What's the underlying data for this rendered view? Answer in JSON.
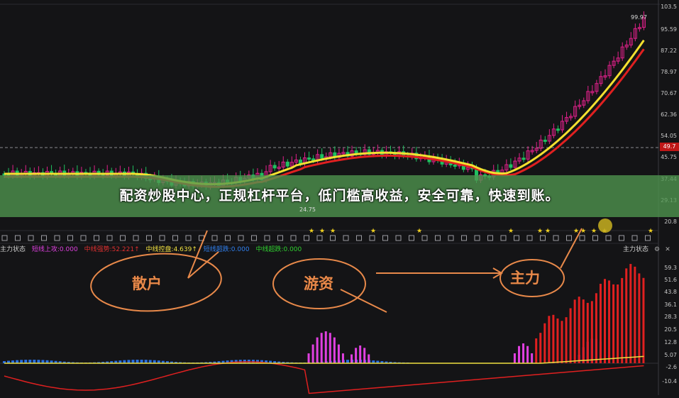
{
  "banner": {
    "text": "配资炒股中心，正规杠杆平台，低门槛高收益，安全可靠，快速到账。"
  },
  "price_axis": {
    "ticks": [
      "103.5",
      "95.59",
      "87.22",
      "78.97",
      "70.67",
      "62.36",
      "54.05",
      "45.75",
      "37.44",
      "29.13",
      "20.8"
    ],
    "current": "49.7"
  },
  "labels": {
    "high": "99.97",
    "low": "24.75"
  },
  "indicator": {
    "title": "主力状态",
    "right_title": "主力状态",
    "items": [
      {
        "label": "短线上攻:0.000",
        "color": "#e040e0"
      },
      {
        "label": "中线强势:52.221",
        "color": "#e03030",
        "arrow": "↑"
      },
      {
        "label": "中线控盘:4.639",
        "color": "#f0e040",
        "arrow": "↑"
      },
      {
        "label": "短线超跌:0.000",
        "color": "#3080f0"
      },
      {
        "label": "中线超跌:0.000",
        "color": "#30d030"
      }
    ],
    "axis": [
      "59.3",
      "51.6",
      "43.8",
      "36.1",
      "28.3",
      "20.5",
      "12.8",
      "5.07",
      "-2.6",
      "-10.4"
    ]
  },
  "annotations": {
    "retail": "散户",
    "hot_money": "游资",
    "main_force": "主力"
  },
  "colors": {
    "up": "#e0208a",
    "down": "#20c060",
    "ma_fast": "#f4e030",
    "ma_slow": "#e02020"
  }
}
